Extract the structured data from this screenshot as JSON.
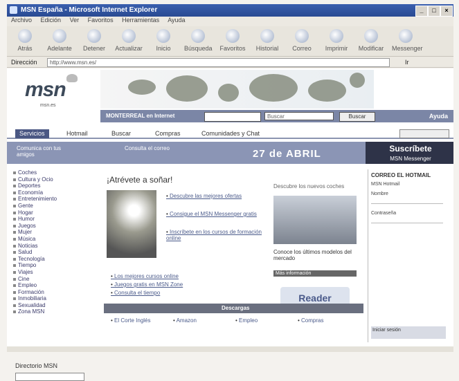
{
  "window": {
    "title": "MSN España - Microsoft Internet Explorer"
  },
  "menubar": [
    "Archivo",
    "Edición",
    "Ver",
    "Favoritos",
    "Herramientas",
    "Ayuda"
  ],
  "toolbar": [
    "Atrás",
    "Adelante",
    "Detener",
    "Actualizar",
    "Inicio",
    "Búsqueda",
    "Favoritos",
    "Historial",
    "Correo",
    "Imprimir",
    "Modificar",
    "Messenger"
  ],
  "address": {
    "label": "Dirección",
    "value": "http://www.msn.es/",
    "go": "Ir"
  },
  "logo": {
    "brand": "msn",
    "sub": "msn.es"
  },
  "search": {
    "label": "MONTERREAL en Internet",
    "select": "Buscar",
    "button": "Buscar",
    "help": "Ayuda"
  },
  "tabs": [
    "Servicios",
    "Hotmail",
    "Buscar",
    "Compras",
    "Comunidades y Chat"
  ],
  "promo": {
    "left": "Comunica con tus amigos",
    "mid": "Consulta el correo",
    "date": "27 de ABRIL"
  },
  "ad": {
    "line1": "Suscríbete",
    "line2": "MSN Messenger"
  },
  "sidebar": {
    "items": [
      "Coches",
      "Cultura y Ocio",
      "Deportes",
      "Economía",
      "Entretenimiento",
      "Gente",
      "Hogar",
      "Humor",
      "Juegos",
      "Mujer",
      "Música",
      "Noticias",
      "Salud",
      "Tecnología",
      "Tiempo",
      "Viajes",
      "Cine",
      "Empleo",
      "Formación",
      "Inmobiliaria",
      "Sexualidad",
      "Zona MSN"
    ],
    "header": "Directorio MSN"
  },
  "center": {
    "heading": "¡Atrévete a soñar!",
    "links": [
      "Descubre las mejores ofertas",
      "Consigue el MSN Messenger gratis",
      "Inscríbete en los cursos de formación online"
    ],
    "bottom_links": [
      "Los mejores cursos online",
      "Juegos gratis en MSN Zone",
      "Consulta el tiempo"
    ]
  },
  "right": {
    "caption_top": "Descubre los nuevos coches",
    "caption": "Conoce los últimos modelos del mercado",
    "bar": "Más información",
    "reader": "Reader"
  },
  "mail": {
    "title": "CORREO EL HOTMAIL",
    "l1": "MSN Hotmail",
    "l2": "Nombre",
    "l3": "Contraseña",
    "foot": "Iniciar sesión"
  },
  "strip": {
    "label": "Descargas"
  },
  "bottom": [
    "El Corte Inglés",
    "Amazon",
    "Empleo",
    "Compras"
  ]
}
